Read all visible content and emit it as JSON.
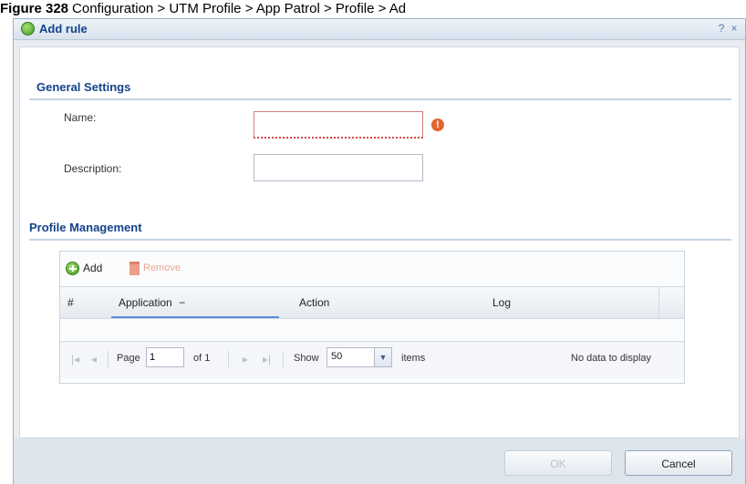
{
  "caption": {
    "label": "Figure 328",
    "text": "Configuration > UTM Profile > App Patrol > Profile > Ad"
  },
  "dialog": {
    "title": "Add rule",
    "help_symbol": "?",
    "close_symbol": "×"
  },
  "general": {
    "title": "General Settings",
    "name_label": "Name:",
    "name_value": "",
    "description_label": "Description:",
    "description_value": ""
  },
  "profile": {
    "title": "Profile Management",
    "add_label": "Add",
    "remove_label": "Remove",
    "columns": [
      "#",
      "Application",
      "Action",
      "Log"
    ],
    "sort_indicator": "−"
  },
  "pager": {
    "page_label": "Page",
    "page_value": "1",
    "of_label": "of 1",
    "show_label": "Show",
    "page_size": "50",
    "items_label": "items",
    "status": "No data to display"
  },
  "buttons": {
    "ok": "OK",
    "cancel": "Cancel"
  }
}
